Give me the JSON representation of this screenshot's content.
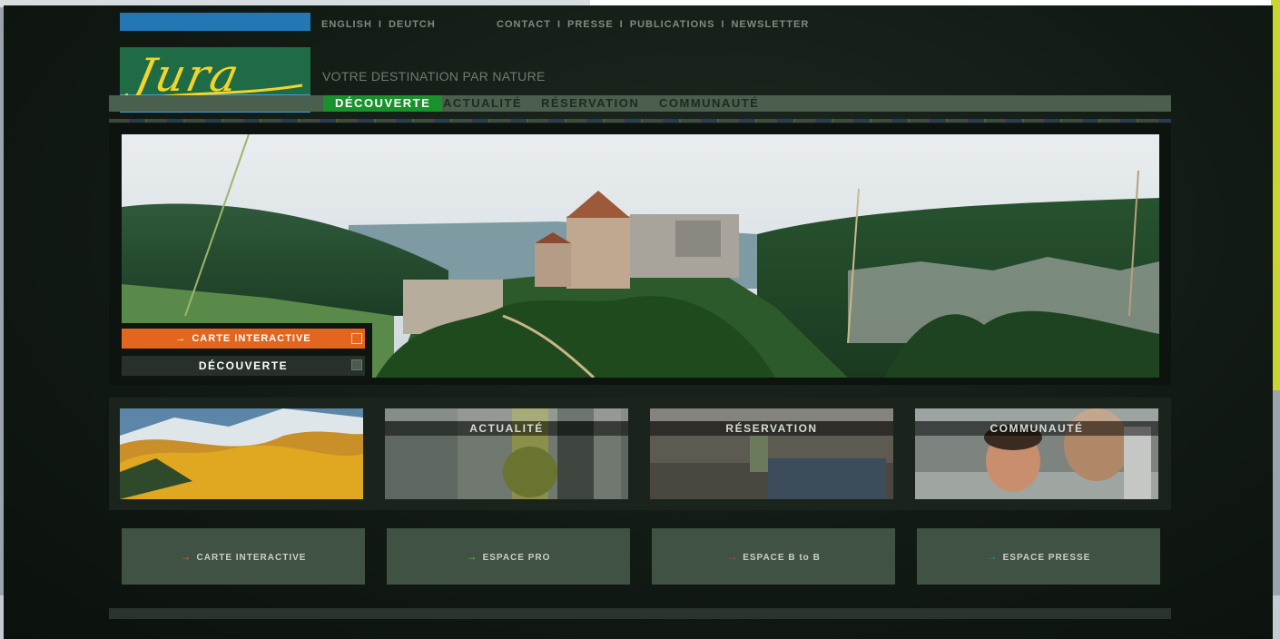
{
  "header": {
    "languages": [
      "ENGLISH",
      "DEUTCH"
    ],
    "utility_links": [
      "CONTACT",
      "PRESSE",
      "PUBLICATIONS",
      "NEWSLETTER"
    ],
    "logo_text": "Jura",
    "tagline": "VOTRE DESTINATION PAR NATURE"
  },
  "main_nav": {
    "items": [
      "DÉCOUVERTE",
      "ACTUALITÉ",
      "RÉSERVATION",
      "COMMUNAUTÉ"
    ],
    "active": "DÉCOUVERTE"
  },
  "hero": {
    "map_button": "CARTE INTERACTIVE",
    "section_button": "DÉCOUVERTE"
  },
  "tiles": [
    {
      "caption": ""
    },
    {
      "caption": "ACTUALITÉ"
    },
    {
      "caption": "RÉSERVATION"
    },
    {
      "caption": "COMMUNAUTÉ"
    }
  ],
  "bottom_buttons": [
    {
      "label": "CARTE INTERACTIVE",
      "arrow_color": "#e2661d"
    },
    {
      "label": "ESPACE PRO",
      "arrow_color": "#5fd23b"
    },
    {
      "label": "ESPACE B to B",
      "arrow_color": "#e02c78"
    },
    {
      "label": "ESPACE PRESSE",
      "arrow_color": "#2d8ac9"
    }
  ],
  "colors": {
    "brand_blue": "#2277b4",
    "brand_green": "#19912c",
    "logo_yellow": "#f2d42a",
    "accent_orange": "#e2661d",
    "frame_accent": "#c9d62b"
  },
  "icons": {
    "arrow": "right-arrow-icon",
    "square": "expand-square-icon"
  }
}
